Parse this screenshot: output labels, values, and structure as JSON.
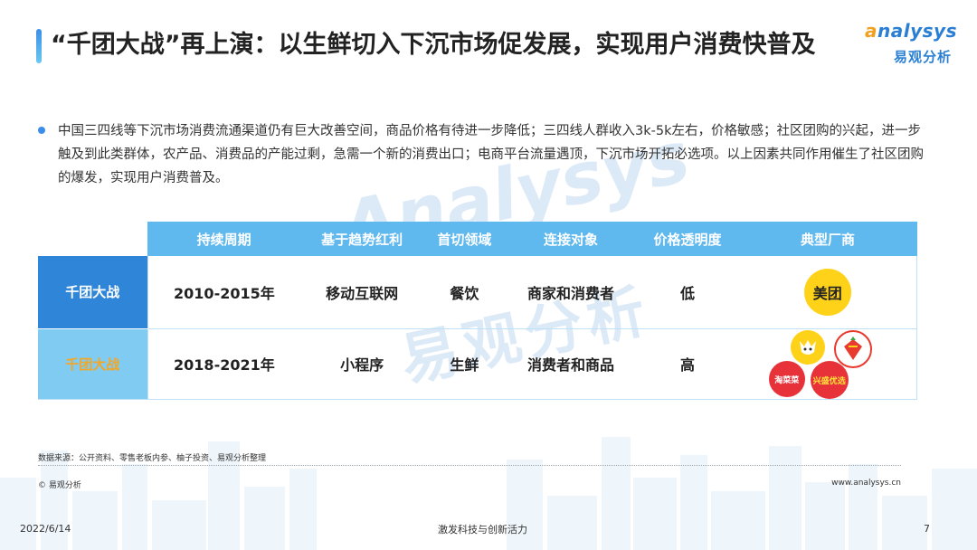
{
  "title": "“千团大战”再上演：以生鲜切入下沉市场促发展，实现用户消费快普及",
  "logo": {
    "en_a": "a",
    "en_rest": "nalysys",
    "cn": "易观分析"
  },
  "watermark": {
    "en": "Analysys",
    "cn": "易观分析"
  },
  "bullet": "中国三四线等下沉市场消费流通渠道仍有巨大改善空间，商品价格有待进一步降低；三四线人群收入3k-5k左右，价格敏感；社区团购的兴起，进一步触及到此类群体，农产品、消费品的产能过剩，急需一个新的消费出口；电商平台流量遇顶，下沉市场开拓必选项。以上因素共同作用催生了社区团购的爆发，实现用户消费普及。",
  "table": {
    "headers": [
      "持续周期",
      "基于趋势红利",
      "首切领域",
      "连接对象",
      "价格透明度",
      "典型厂商"
    ],
    "rows": [
      {
        "label": "千团大战",
        "period": "2010-2015年",
        "trend": "移动互联网",
        "field": "餐饮",
        "connect": "商家和消费者",
        "price": "低",
        "vendors": [
          "美团"
        ]
      },
      {
        "label": "千团大战",
        "period": "2018-2021年",
        "trend": "小程序",
        "field": "生鲜",
        "connect": "消费者和商品",
        "price": "高",
        "vendors": [
          "淘菜菜",
          "兴盛优选"
        ]
      }
    ]
  },
  "source": "数据来源：公开资料、零售老板内参、柚子投资、易观分析整理",
  "copyright": "© 易观分析",
  "website": "www.analysys.cn",
  "footer": {
    "date": "2022/6/14",
    "slogan": "激发科技与创新活力",
    "page": "7"
  },
  "colors": {
    "accent": "#2f86d8",
    "header_bg": "#5fb8ee",
    "highlight": "#f5a623"
  }
}
